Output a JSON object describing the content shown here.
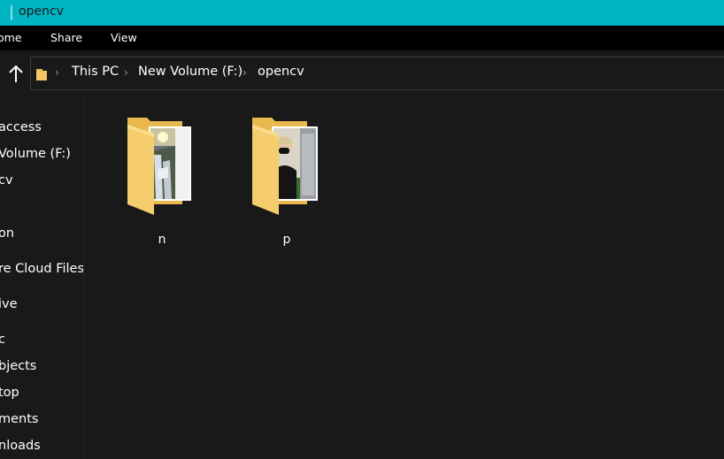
{
  "window": {
    "title": "opencv"
  },
  "ribbon": {
    "tabs": [
      "ome",
      "Share",
      "View"
    ]
  },
  "address": {
    "crumbs": [
      "This PC",
      "New Volume (F:)",
      "opencv"
    ]
  },
  "navpane": {
    "items": [
      "access",
      "Volume (F:)",
      "cv",
      "on",
      "re Cloud Files",
      "ive",
      "c",
      "bjects",
      "top",
      "ments",
      "nloads"
    ]
  },
  "content": {
    "folders": [
      {
        "name": "n",
        "thumbnail": "waterfall-photo"
      },
      {
        "name": "p",
        "thumbnail": "person-masked-photo"
      }
    ]
  },
  "colors": {
    "titlebar": "#00b4c2",
    "folder": "#f3c766",
    "background": "#191919"
  },
  "icons": [
    "up-arrow-icon",
    "folder-icon",
    "chevron-right-icon"
  ]
}
